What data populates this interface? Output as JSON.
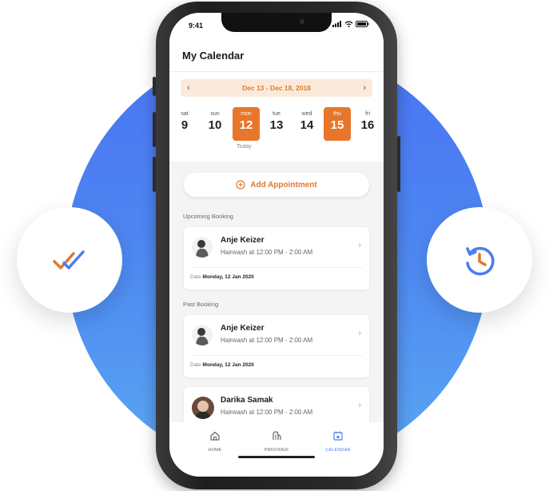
{
  "status": {
    "time": "9:41"
  },
  "header": {
    "title": "My Calendar"
  },
  "range": {
    "text": "Dec 13 - Dec 18, 2018",
    "prev": "‹",
    "next": "›"
  },
  "days": [
    {
      "name": "sat",
      "num": "9",
      "selected": false
    },
    {
      "name": "sun",
      "num": "10",
      "selected": false
    },
    {
      "name": "mon",
      "num": "12",
      "selected": true
    },
    {
      "name": "tue",
      "num": "13",
      "selected": false
    },
    {
      "name": "wed",
      "num": "14",
      "selected": false
    },
    {
      "name": "thu",
      "num": "15",
      "selected": true
    },
    {
      "name": "fri",
      "num": "16",
      "selected": false
    }
  ],
  "today_label": "Today",
  "add_button": {
    "label": "Add Appointment"
  },
  "sections": {
    "upcoming": "Upcoming Booking",
    "past": "Past Booking"
  },
  "bookings": [
    {
      "name": "Anje Keizer",
      "service": "Hairwash at 12:00 PM - 2:00 AM",
      "date_label": "Date",
      "date": "Monday, 12 Jan 2020"
    },
    {
      "name": "Anje Keizer",
      "service": "Hairwash at 12:00 PM - 2:00 AM",
      "date_label": "Date",
      "date": "Monday, 12 Jan 2020"
    },
    {
      "name": "Darika Samak",
      "service": "Hairwash at 12:00 PM - 2:00 AM"
    }
  ],
  "tabs": [
    {
      "label": "HOME",
      "icon": "home-icon"
    },
    {
      "label": "PROVIDER",
      "icon": "provider-icon"
    },
    {
      "label": "CALENDAR",
      "icon": "calendar-icon"
    }
  ],
  "colors": {
    "accent": "#e7762b",
    "blue": "#4c7cf4",
    "circle": "#4a73f3"
  }
}
